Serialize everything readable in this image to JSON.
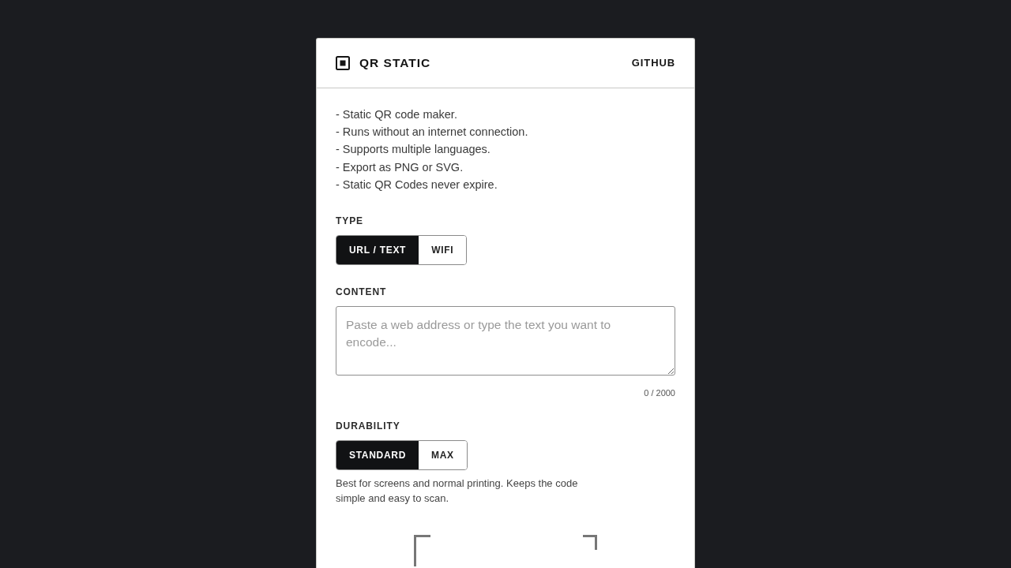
{
  "header": {
    "title": "QR STATIC",
    "link": "GITHUB"
  },
  "features": [
    "- Static QR code maker.",
    "- Runs without an internet connection.",
    "- Supports multiple languages.",
    "- Export as PNG or SVG.",
    "- Static QR Codes never expire."
  ],
  "type": {
    "label": "TYPE",
    "options": [
      {
        "label": "URL / TEXT",
        "selected": true
      },
      {
        "label": "WIFI",
        "selected": false
      }
    ]
  },
  "content": {
    "label": "CONTENT",
    "placeholder": "Paste a web address or type the text you want to encode...",
    "counter": "0 / 2000"
  },
  "durability": {
    "label": "DURABILITY",
    "options": [
      {
        "label": "STANDARD",
        "selected": true
      },
      {
        "label": "MAX",
        "selected": false
      }
    ],
    "description": "Best for screens and normal printing. Keeps the code simple and easy to scan."
  }
}
